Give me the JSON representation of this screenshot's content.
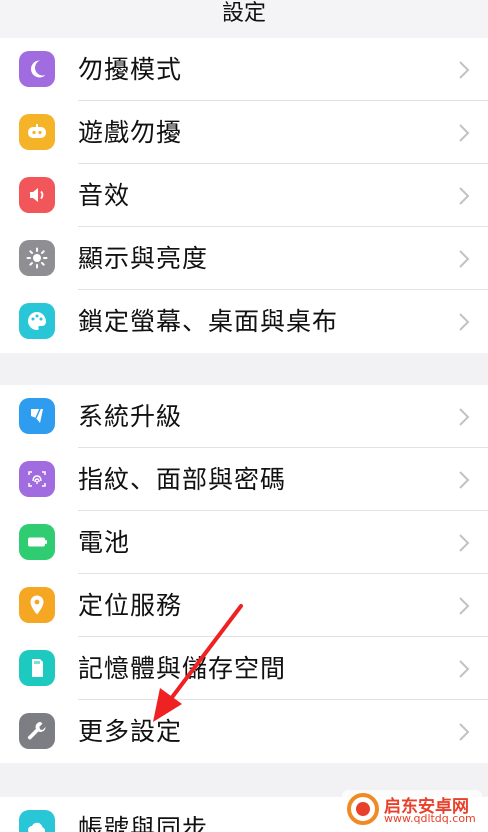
{
  "header": {
    "title": "設定"
  },
  "group1": [
    {
      "label": "勿擾模式",
      "icon": "moon-icon",
      "color": "#a06ce0"
    },
    {
      "label": "遊戲勿擾",
      "icon": "game-controller-icon",
      "color": "#f5b328"
    },
    {
      "label": "音效",
      "icon": "speaker-icon",
      "color": "#f0565a"
    },
    {
      "label": "顯示與亮度",
      "icon": "sun-icon",
      "color": "#8e8e93"
    },
    {
      "label": "鎖定螢幕、桌面與桌布",
      "icon": "palette-icon",
      "color": "#29c6d8"
    }
  ],
  "group2": [
    {
      "label": "系統升級",
      "icon": "update-icon",
      "color": "#2e9df0"
    },
    {
      "label": "指紋、面部與密碼",
      "icon": "fingerprint-icon",
      "color": "#a06ce0"
    },
    {
      "label": "電池",
      "icon": "battery-icon",
      "color": "#2fcc71"
    },
    {
      "label": "定位服務",
      "icon": "location-pin-icon",
      "color": "#f5a623"
    },
    {
      "label": "記憶體與儲存空間",
      "icon": "storage-icon",
      "color": "#1ec9c0"
    },
    {
      "label": "更多設定",
      "icon": "wrench-icon",
      "color": "#7d7d84"
    }
  ],
  "group3": [
    {
      "label": "帳號與同步",
      "icon": "cloud-icon",
      "color": "#29c6d8"
    }
  ],
  "watermark": {
    "title": "启东安卓网",
    "url": "www.qdltdq.com"
  }
}
